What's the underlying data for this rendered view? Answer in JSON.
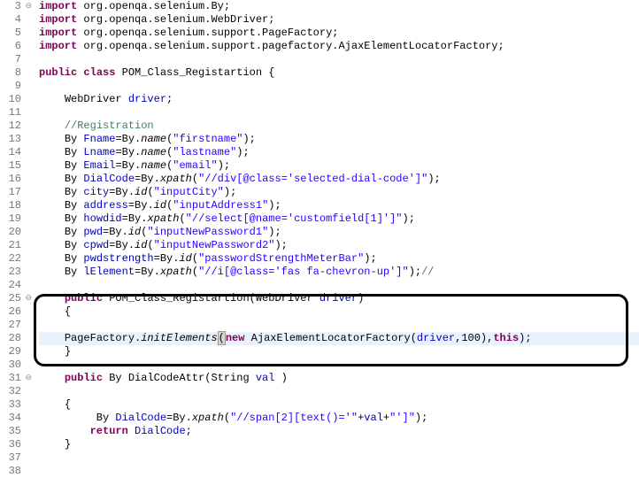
{
  "lines": [
    {
      "num": "3",
      "fold": "⊖",
      "indent": 0,
      "tokens": [
        [
          "kw",
          "import"
        ],
        [
          "plain",
          " org.openqa.selenium.By;"
        ]
      ]
    },
    {
      "num": "4",
      "fold": "",
      "indent": 0,
      "tokens": [
        [
          "kw",
          "import"
        ],
        [
          "plain",
          " org.openqa.selenium.WebDriver;"
        ]
      ]
    },
    {
      "num": "5",
      "fold": "",
      "indent": 0,
      "tokens": [
        [
          "kw",
          "import"
        ],
        [
          "plain",
          " org.openqa.selenium.support.PageFactory;"
        ]
      ]
    },
    {
      "num": "6",
      "fold": "",
      "indent": 0,
      "tokens": [
        [
          "kw",
          "import"
        ],
        [
          "plain",
          " org.openqa.selenium.support.pagefactory.AjaxElementLocatorFactory;"
        ]
      ]
    },
    {
      "num": "7",
      "fold": "",
      "indent": 0,
      "tokens": []
    },
    {
      "num": "8",
      "fold": "",
      "indent": 0,
      "tokens": [
        [
          "kw",
          "public"
        ],
        [
          "plain",
          " "
        ],
        [
          "kw",
          "class"
        ],
        [
          "plain",
          " POM_Class_Registartion {"
        ]
      ]
    },
    {
      "num": "9",
      "fold": "",
      "indent": 0,
      "tokens": []
    },
    {
      "num": "10",
      "fold": "",
      "indent": 1,
      "tokens": [
        [
          "plain",
          "WebDriver "
        ],
        [
          "ident",
          "driver"
        ],
        [
          "plain",
          ";"
        ]
      ]
    },
    {
      "num": "11",
      "fold": "",
      "indent": 0,
      "tokens": []
    },
    {
      "num": "12",
      "fold": "",
      "indent": 1,
      "tokens": [
        [
          "comment",
          "//Registration"
        ]
      ]
    },
    {
      "num": "13",
      "fold": "",
      "indent": 1,
      "tokens": [
        [
          "plain",
          "By "
        ],
        [
          "ident",
          "Fname"
        ],
        [
          "plain",
          "=By."
        ],
        [
          "method-static",
          "name"
        ],
        [
          "plain",
          "("
        ],
        [
          "str",
          "\"firstname\""
        ],
        [
          "plain",
          ");"
        ]
      ]
    },
    {
      "num": "14",
      "fold": "",
      "indent": 1,
      "tokens": [
        [
          "plain",
          "By "
        ],
        [
          "ident",
          "Lname"
        ],
        [
          "plain",
          "=By."
        ],
        [
          "method-static",
          "name"
        ],
        [
          "plain",
          "("
        ],
        [
          "str",
          "\"lastname\""
        ],
        [
          "plain",
          ");"
        ]
      ]
    },
    {
      "num": "15",
      "fold": "",
      "indent": 1,
      "tokens": [
        [
          "plain",
          "By "
        ],
        [
          "ident",
          "Email"
        ],
        [
          "plain",
          "=By."
        ],
        [
          "method-static",
          "name"
        ],
        [
          "plain",
          "("
        ],
        [
          "str",
          "\"email\""
        ],
        [
          "plain",
          ");"
        ]
      ]
    },
    {
      "num": "16",
      "fold": "",
      "indent": 1,
      "tokens": [
        [
          "plain",
          "By "
        ],
        [
          "ident",
          "DialCode"
        ],
        [
          "plain",
          "=By."
        ],
        [
          "method-static",
          "xpath"
        ],
        [
          "plain",
          "("
        ],
        [
          "str",
          "\"//div[@class='selected-dial-code']\""
        ],
        [
          "plain",
          ");"
        ]
      ]
    },
    {
      "num": "17",
      "fold": "",
      "indent": 1,
      "tokens": [
        [
          "plain",
          "By "
        ],
        [
          "ident",
          "city"
        ],
        [
          "plain",
          "=By."
        ],
        [
          "method-static",
          "id"
        ],
        [
          "plain",
          "("
        ],
        [
          "str",
          "\"inputCity\""
        ],
        [
          "plain",
          ");"
        ]
      ]
    },
    {
      "num": "18",
      "fold": "",
      "indent": 1,
      "tokens": [
        [
          "plain",
          "By "
        ],
        [
          "ident",
          "address"
        ],
        [
          "plain",
          "=By."
        ],
        [
          "method-static",
          "id"
        ],
        [
          "plain",
          "("
        ],
        [
          "str",
          "\"inputAddress1\""
        ],
        [
          "plain",
          ");"
        ]
      ]
    },
    {
      "num": "19",
      "fold": "",
      "indent": 1,
      "tokens": [
        [
          "plain",
          "By "
        ],
        [
          "ident",
          "howdid"
        ],
        [
          "plain",
          "=By."
        ],
        [
          "method-static",
          "xpath"
        ],
        [
          "plain",
          "("
        ],
        [
          "str",
          "\"//select[@name='customfield[1]']\""
        ],
        [
          "plain",
          ");"
        ]
      ]
    },
    {
      "num": "20",
      "fold": "",
      "indent": 1,
      "tokens": [
        [
          "plain",
          "By "
        ],
        [
          "ident",
          "pwd"
        ],
        [
          "plain",
          "=By."
        ],
        [
          "method-static",
          "id"
        ],
        [
          "plain",
          "("
        ],
        [
          "str",
          "\"inputNewPassword1\""
        ],
        [
          "plain",
          ");"
        ]
      ]
    },
    {
      "num": "21",
      "fold": "",
      "indent": 1,
      "tokens": [
        [
          "plain",
          "By "
        ],
        [
          "ident",
          "cpwd"
        ],
        [
          "plain",
          "=By."
        ],
        [
          "method-static",
          "id"
        ],
        [
          "plain",
          "("
        ],
        [
          "str",
          "\"inputNewPassword2\""
        ],
        [
          "plain",
          ");"
        ]
      ]
    },
    {
      "num": "22",
      "fold": "",
      "indent": 1,
      "tokens": [
        [
          "plain",
          "By "
        ],
        [
          "ident",
          "pwdstrength"
        ],
        [
          "plain",
          "=By."
        ],
        [
          "method-static",
          "id"
        ],
        [
          "plain",
          "("
        ],
        [
          "str",
          "\"passwordStrengthMeterBar\""
        ],
        [
          "plain",
          ");"
        ]
      ]
    },
    {
      "num": "23",
      "fold": "",
      "indent": 1,
      "tokens": [
        [
          "plain",
          "By "
        ],
        [
          "ident",
          "lElement"
        ],
        [
          "plain",
          "=By."
        ],
        [
          "method-static",
          "xpath"
        ],
        [
          "plain",
          "("
        ],
        [
          "str",
          "\"//i[@class='fas fa-chevron-up']\""
        ],
        [
          "plain",
          ");"
        ],
        [
          "comment",
          "//"
        ]
      ]
    },
    {
      "num": "24",
      "fold": "",
      "indent": 0,
      "tokens": []
    },
    {
      "num": "25",
      "fold": "⊖",
      "indent": 1,
      "tokens": [
        [
          "kw",
          "public"
        ],
        [
          "plain",
          " POM_Class_Registartion(WebDriver "
        ],
        [
          "ident",
          "driver"
        ],
        [
          "plain",
          ")"
        ]
      ]
    },
    {
      "num": "26",
      "fold": "",
      "indent": 1,
      "tokens": [
        [
          "plain",
          "{"
        ]
      ]
    },
    {
      "num": "27",
      "fold": "",
      "indent": 0,
      "tokens": []
    },
    {
      "num": "28",
      "fold": "",
      "indent": 1,
      "highlight": true,
      "tokens": [
        [
          "plain",
          "PageFactory."
        ],
        [
          "method-static",
          "initElements"
        ],
        [
          "bracket",
          "("
        ],
        [
          "kw",
          "new"
        ],
        [
          "plain",
          " AjaxElementLocatorFactory("
        ],
        [
          "ident",
          "driver"
        ],
        [
          "plain",
          ",100),"
        ],
        [
          "kw",
          "this"
        ],
        [
          "plain",
          ");"
        ]
      ]
    },
    {
      "num": "29",
      "fold": "",
      "indent": 1,
      "tokens": [
        [
          "plain",
          "}"
        ]
      ]
    },
    {
      "num": "30",
      "fold": "",
      "indent": 0,
      "tokens": []
    },
    {
      "num": "31",
      "fold": "⊖",
      "indent": 1,
      "tokens": [
        [
          "kw",
          "public"
        ],
        [
          "plain",
          " By DialCodeAttr(String "
        ],
        [
          "ident",
          "val"
        ],
        [
          "plain",
          " )"
        ]
      ]
    },
    {
      "num": "32",
      "fold": "",
      "indent": 0,
      "tokens": []
    },
    {
      "num": "33",
      "fold": "",
      "indent": 1,
      "tokens": [
        [
          "plain",
          "{"
        ]
      ]
    },
    {
      "num": "34",
      "fold": "",
      "indent": 2,
      "tokens": [
        [
          "plain",
          " By "
        ],
        [
          "ident",
          "DialCode"
        ],
        [
          "plain",
          "=By."
        ],
        [
          "method-static",
          "xpath"
        ],
        [
          "plain",
          "("
        ],
        [
          "str",
          "\"//span[2][text()='\""
        ],
        [
          "plain",
          "+"
        ],
        [
          "ident",
          "val"
        ],
        [
          "plain",
          "+"
        ],
        [
          "str",
          "\"']\""
        ],
        [
          "plain",
          ");"
        ]
      ]
    },
    {
      "num": "35",
      "fold": "",
      "indent": 2,
      "tokens": [
        [
          "kw",
          "return"
        ],
        [
          "plain",
          " "
        ],
        [
          "ident",
          "DialCode"
        ],
        [
          "plain",
          ";"
        ]
      ]
    },
    {
      "num": "36",
      "fold": "",
      "indent": 1,
      "tokens": [
        [
          "plain",
          "}"
        ]
      ]
    },
    {
      "num": "37",
      "fold": "",
      "indent": 0,
      "tokens": []
    },
    {
      "num": "38",
      "fold": "",
      "indent": 0,
      "tokens": []
    }
  ]
}
